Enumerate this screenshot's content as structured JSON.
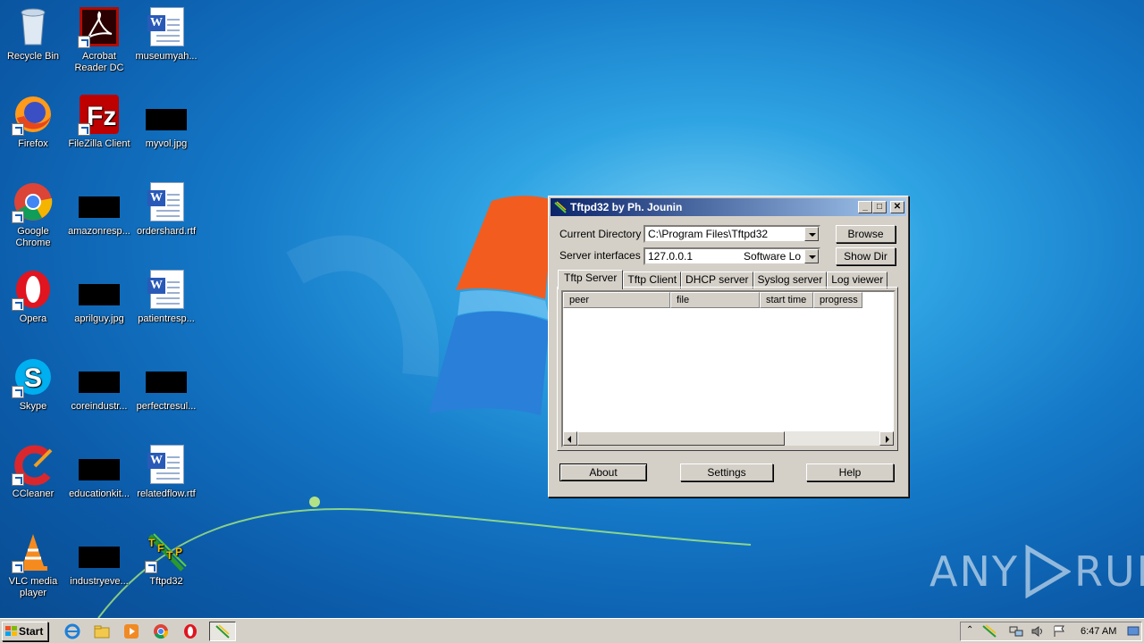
{
  "desktop": {
    "icons": [
      {
        "label": "Recycle Bin"
      },
      {
        "label": "Acrobat Reader DC"
      },
      {
        "label": "museumyah..."
      },
      {
        "label": "Firefox"
      },
      {
        "label": "FileZilla Client"
      },
      {
        "label": "myvol.jpg"
      },
      {
        "label": "Google Chrome"
      },
      {
        "label": "amazonresp..."
      },
      {
        "label": "ordershard.rtf"
      },
      {
        "label": "Opera"
      },
      {
        "label": "aprilguy.jpg"
      },
      {
        "label": "patientresp..."
      },
      {
        "label": "Skype"
      },
      {
        "label": "coreindustr..."
      },
      {
        "label": "perfectresul..."
      },
      {
        "label": "CCleaner"
      },
      {
        "label": "educationkit..."
      },
      {
        "label": "relatedflow.rtf"
      },
      {
        "label": "VLC media player"
      },
      {
        "label": "industryeve..."
      },
      {
        "label": "Tftpd32"
      }
    ]
  },
  "window": {
    "title": "Tftpd32 by Ph. Jounin",
    "current_directory_label": "Current Directory",
    "current_directory_value": "C:\\Program Files\\Tftpd32",
    "server_interfaces_label": "Server interfaces",
    "server_interfaces_value": "127.0.0.1",
    "server_interfaces_suffix": "Software Lo",
    "browse_label": "Browse",
    "show_dir_label": "Show Dir",
    "tabs": [
      {
        "label": "Tftp Server"
      },
      {
        "label": "Tftp Client"
      },
      {
        "label": "DHCP server"
      },
      {
        "label": "Syslog server"
      },
      {
        "label": "Log viewer"
      }
    ],
    "columns": [
      {
        "label": "peer"
      },
      {
        "label": "file"
      },
      {
        "label": "start time"
      },
      {
        "label": "progress"
      }
    ],
    "about_label": "About",
    "settings_label": "Settings",
    "help_label": "Help"
  },
  "taskbar": {
    "start_label": "Start",
    "clock": "6:47 AM"
  },
  "watermark": {
    "left": "ANY",
    "right": "RUN"
  },
  "colors": {
    "titlebar_start": "#0a246a",
    "titlebar_end": "#a6caf0",
    "dialog_bg": "#d4d0c8"
  }
}
